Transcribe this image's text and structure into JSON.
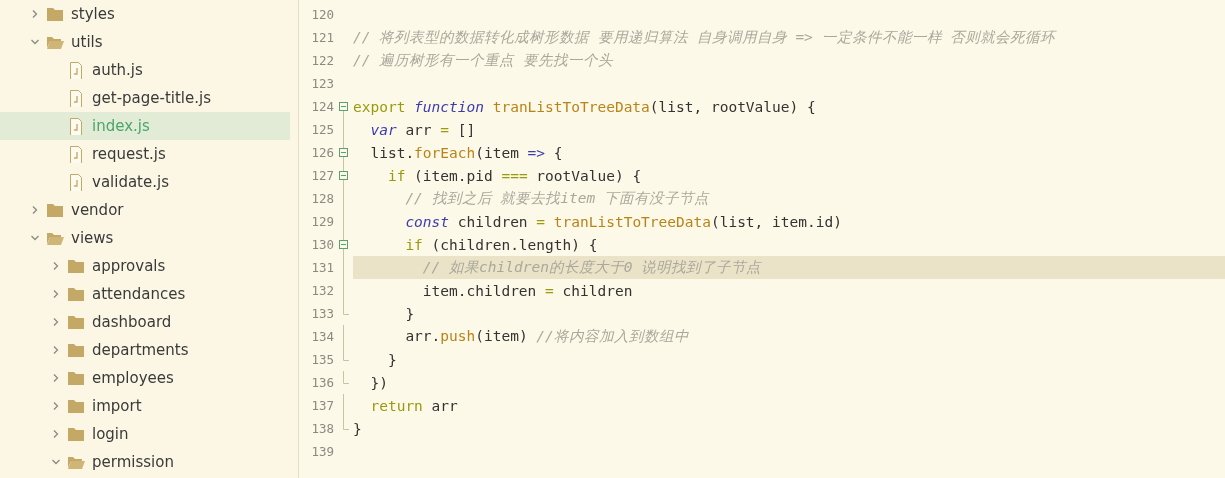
{
  "sidebar": {
    "items": [
      {
        "kind": "folder",
        "label": "styles",
        "expanded": false,
        "selected": false
      },
      {
        "kind": "folder",
        "label": "utils",
        "expanded": true,
        "selected": false,
        "children": [
          {
            "kind": "file",
            "label": "auth.js",
            "selected": false
          },
          {
            "kind": "file",
            "label": "get-page-title.js",
            "selected": false
          },
          {
            "kind": "file",
            "label": "index.js",
            "selected": true
          },
          {
            "kind": "file",
            "label": "request.js",
            "selected": false
          },
          {
            "kind": "file",
            "label": "validate.js",
            "selected": false
          }
        ]
      },
      {
        "kind": "folder",
        "label": "vendor",
        "expanded": false,
        "selected": false
      },
      {
        "kind": "folder",
        "label": "views",
        "expanded": true,
        "selected": false,
        "children": [
          {
            "kind": "folder",
            "label": "approvals",
            "expanded": false,
            "selected": false
          },
          {
            "kind": "folder",
            "label": "attendances",
            "expanded": false,
            "selected": false
          },
          {
            "kind": "folder",
            "label": "dashboard",
            "expanded": false,
            "selected": false
          },
          {
            "kind": "folder",
            "label": "departments",
            "expanded": false,
            "selected": false
          },
          {
            "kind": "folder",
            "label": "employees",
            "expanded": false,
            "selected": false
          },
          {
            "kind": "folder",
            "label": "import",
            "expanded": false,
            "selected": false
          },
          {
            "kind": "folder",
            "label": "login",
            "expanded": false,
            "selected": false
          },
          {
            "kind": "folder",
            "label": "permission",
            "expanded": true,
            "selected": false
          }
        ]
      }
    ]
  },
  "editor": {
    "lines": [
      {
        "number": "120",
        "kind": "plain",
        "current": false
      },
      {
        "number": "121",
        "kind": "plain",
        "current": false,
        "tokens": [
          {
            "kind": "comment",
            "text": "// 将列表型的数据转化成树形数据 要用递归算法 自身调用自身 => 一定条件不能一样 否则就会死循环"
          }
        ]
      },
      {
        "number": "122",
        "kind": "plain",
        "current": false,
        "tokens": [
          {
            "kind": "comment",
            "text": "// 遍历树形有一个重点 要先找一个头"
          }
        ]
      },
      {
        "number": "123",
        "kind": "plain",
        "current": false
      },
      {
        "number": "124",
        "kind": "fold-start",
        "current": false,
        "tokens": [
          {
            "kind": "keyword",
            "text": "export"
          },
          {
            "kind": "storage",
            "text": " function"
          },
          {
            "kind": "func",
            "text": " tranListToTreeData"
          },
          {
            "kind": "plain",
            "text": "(list, rootValue) {"
          }
        ]
      },
      {
        "number": "125",
        "kind": "plain",
        "current": false,
        "tokens": [
          {
            "kind": "storage",
            "text": "  var"
          },
          {
            "kind": "plain",
            "text": " arr "
          },
          {
            "kind": "operator",
            "text": "="
          },
          {
            "kind": "plain",
            "text": " []"
          }
        ]
      },
      {
        "number": "126",
        "kind": "fold-start",
        "current": false,
        "tokens": [
          {
            "kind": "plain",
            "text": "  list."
          },
          {
            "kind": "func",
            "text": "forEach"
          },
          {
            "kind": "plain",
            "text": "(item "
          },
          {
            "kind": "storage",
            "text": "=>"
          },
          {
            "kind": "plain",
            "text": " {"
          }
        ]
      },
      {
        "number": "127",
        "kind": "fold-start",
        "current": false,
        "tokens": [
          {
            "kind": "keyword",
            "text": "    if"
          },
          {
            "kind": "plain",
            "text": " (item.pid "
          },
          {
            "kind": "operator",
            "text": "==="
          },
          {
            "kind": "plain",
            "text": " rootValue) {"
          }
        ]
      },
      {
        "number": "128",
        "kind": "plain",
        "current": false,
        "tokens": [
          {
            "kind": "comment",
            "text": "      // 找到之后 就要去找item 下面有没子节点"
          }
        ]
      },
      {
        "number": "129",
        "kind": "plain",
        "current": false,
        "tokens": [
          {
            "kind": "storage",
            "text": "      const"
          },
          {
            "kind": "plain",
            "text": " children "
          },
          {
            "kind": "operator",
            "text": "="
          },
          {
            "kind": "func",
            "text": " tranListToTreeData"
          },
          {
            "kind": "plain",
            "text": "(list, item.id)"
          }
        ]
      },
      {
        "number": "130",
        "kind": "fold-start",
        "current": false,
        "tokens": [
          {
            "kind": "keyword",
            "text": "      if"
          },
          {
            "kind": "plain",
            "text": " (children.length) {"
          }
        ]
      },
      {
        "number": "131",
        "kind": "plain",
        "current": true,
        "tokens": [
          {
            "kind": "comment",
            "text": "        // 如果children的长度大于0 说明找到了子节点"
          }
        ]
      },
      {
        "number": "132",
        "kind": "plain",
        "current": false,
        "tokens": [
          {
            "kind": "plain",
            "text": "        item.children "
          },
          {
            "kind": "operator",
            "text": "="
          },
          {
            "kind": "plain",
            "text": " children"
          }
        ]
      },
      {
        "number": "133",
        "kind": "fold-end",
        "current": false,
        "tokens": [
          {
            "kind": "plain",
            "text": "      }"
          }
        ]
      },
      {
        "number": "134",
        "kind": "plain",
        "current": false,
        "tokens": [
          {
            "kind": "plain",
            "text": "      arr."
          },
          {
            "kind": "func",
            "text": "push"
          },
          {
            "kind": "plain",
            "text": "(item) "
          },
          {
            "kind": "comment",
            "text": "//将内容加入到数组中"
          }
        ]
      },
      {
        "number": "135",
        "kind": "fold-end",
        "current": false,
        "tokens": [
          {
            "kind": "plain",
            "text": "    }"
          }
        ]
      },
      {
        "number": "136",
        "kind": "fold-end",
        "current": false,
        "tokens": [
          {
            "kind": "plain",
            "text": "  })"
          }
        ]
      },
      {
        "number": "137",
        "kind": "plain",
        "current": false,
        "tokens": [
          {
            "kind": "keyword",
            "text": "  return"
          },
          {
            "kind": "plain",
            "text": " arr"
          }
        ]
      },
      {
        "number": "138",
        "kind": "fold-end",
        "current": false,
        "tokens": [
          {
            "kind": "plain",
            "text": "}"
          }
        ]
      },
      {
        "number": "139",
        "kind": "plain",
        "current": false
      }
    ]
  }
}
